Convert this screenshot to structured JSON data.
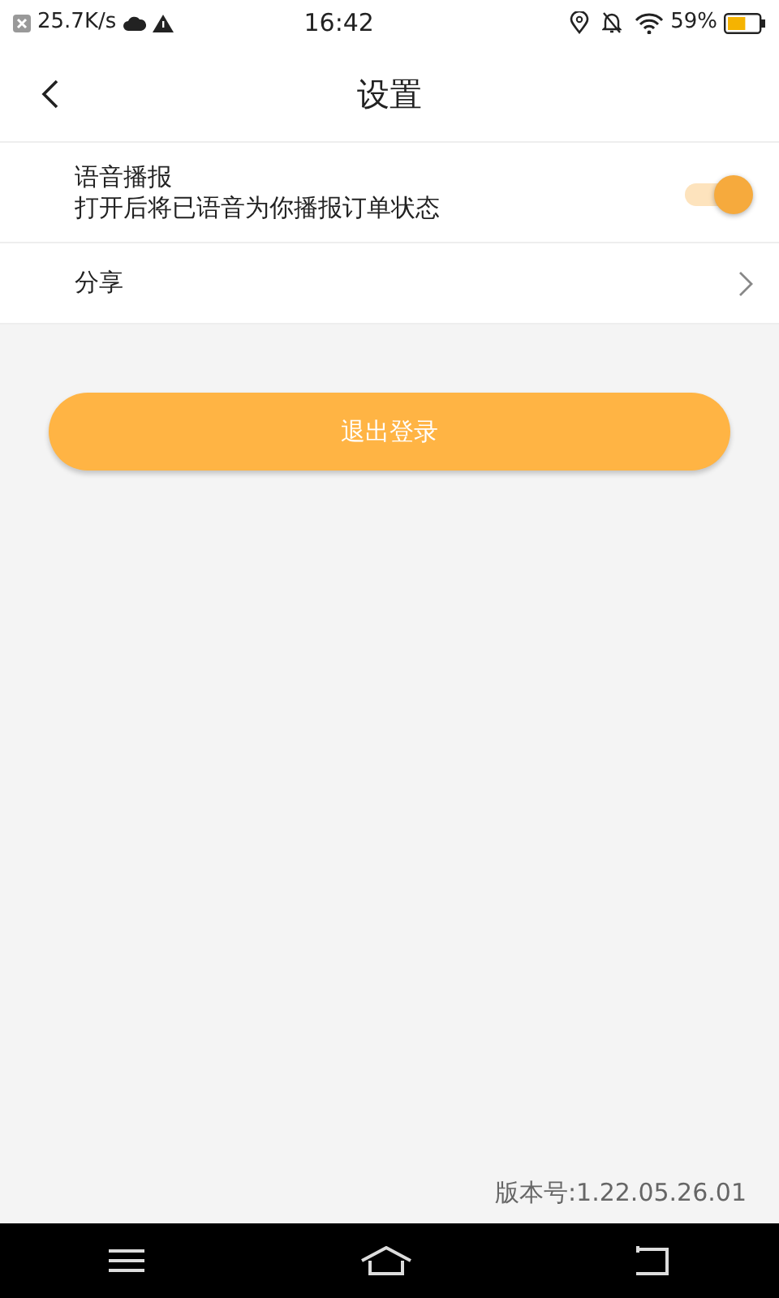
{
  "status_bar": {
    "speed": "25.7K/s",
    "time": "16:42",
    "battery": "59%"
  },
  "header": {
    "title": "设置"
  },
  "settings": [
    {
      "kind": "toggle",
      "label": "语音播报",
      "description": "打开后将已语音为你播报订单状态",
      "on": true
    },
    {
      "kind": "link",
      "label": "分享"
    }
  ],
  "logout_button": "退出登录",
  "version": "版本号:1.22.05.26.01"
}
